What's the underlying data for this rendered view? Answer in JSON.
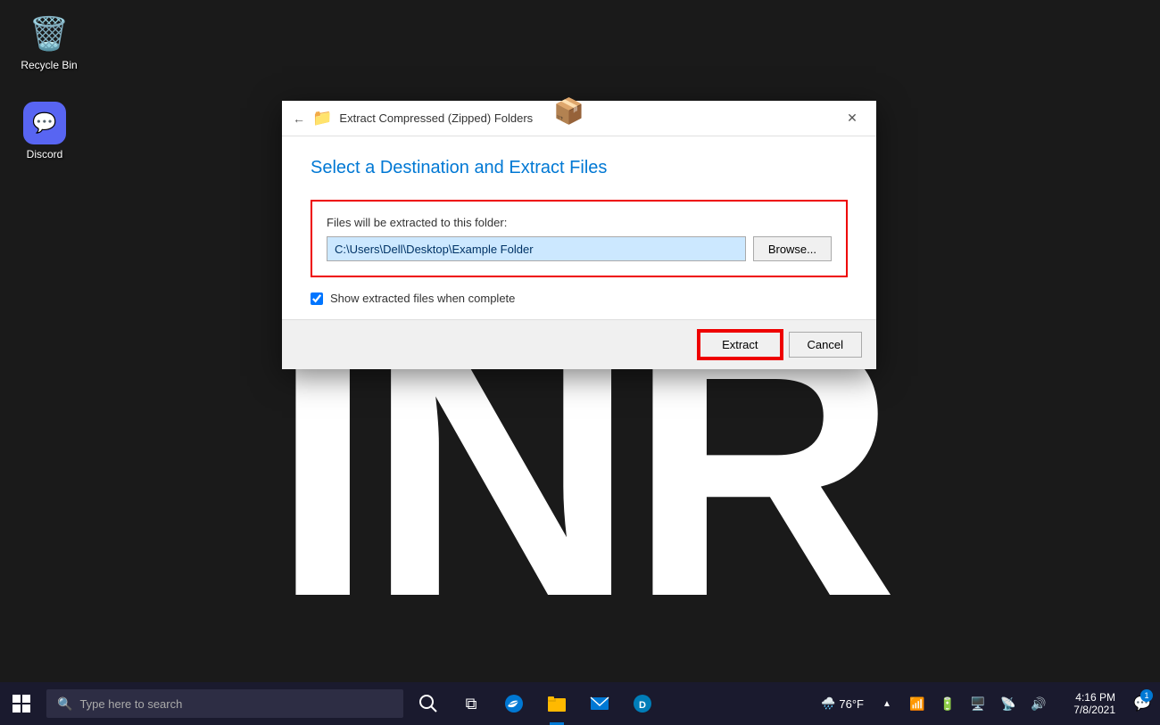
{
  "desktop": {
    "background_color": "#1a1a1a",
    "bg_text": "INR"
  },
  "icons": {
    "recycle_bin": {
      "label": "Recycle Bin",
      "emoji": "🗑️"
    },
    "discord": {
      "label": "Discord",
      "emoji": "🎮"
    }
  },
  "dialog": {
    "title": "Extract Compressed (Zipped) Folders",
    "heading": "Select a Destination and Extract Files",
    "extract_label": "Files will be extracted to this folder:",
    "path_value": "C:\\Users\\Dell\\Desktop\\Example Folder",
    "browse_label": "Browse...",
    "checkbox_label": "Show extracted files when complete",
    "checkbox_checked": true,
    "extract_button": "Extract",
    "cancel_button": "Cancel"
  },
  "taskbar": {
    "search_placeholder": "Type here to search",
    "weather": "76°F",
    "weather_icon": "🌧️",
    "time": "4:16 PM",
    "date": "7/8/2021",
    "notification_count": "1"
  }
}
